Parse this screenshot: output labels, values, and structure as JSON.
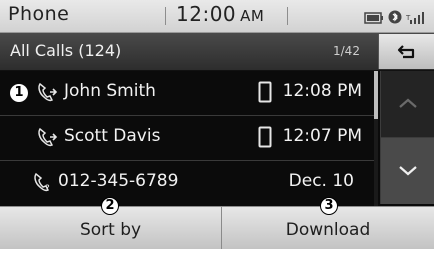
{
  "status_bar": {
    "app_title": "Phone",
    "clock_time": "12:00",
    "clock_ampm": "AM",
    "icons": [
      "battery-icon",
      "bluetooth-icon",
      "signal-icon"
    ]
  },
  "list_header": {
    "title": "All Calls (124)",
    "page": "1/42",
    "back_icon": "back-arrow-icon"
  },
  "calls": [
    {
      "name": "John Smith",
      "type": "outgoing-call-icon",
      "device": "mobile-phone-icon",
      "when": "12:08 PM",
      "marker": "1"
    },
    {
      "name": "Scott Davis",
      "type": "outgoing-call-icon",
      "device": "mobile-phone-icon",
      "when": "12:07 PM"
    },
    {
      "name": "012-345-6789",
      "type": "missed-call-icon",
      "device": "",
      "when": "Dec. 10"
    }
  ],
  "scroll": {
    "up_icon": "chevron-up-icon",
    "down_icon": "chevron-down-icon"
  },
  "bottom_buttons": {
    "sort_label": "Sort by",
    "sort_marker": "2",
    "download_label": "Download",
    "download_marker": "3"
  },
  "colors": {
    "screen_bg": "#0b0b0b",
    "header_bg": "#3a3a3a",
    "button_bg": "#d8d8d8",
    "text_light": "#f2f2f2"
  }
}
